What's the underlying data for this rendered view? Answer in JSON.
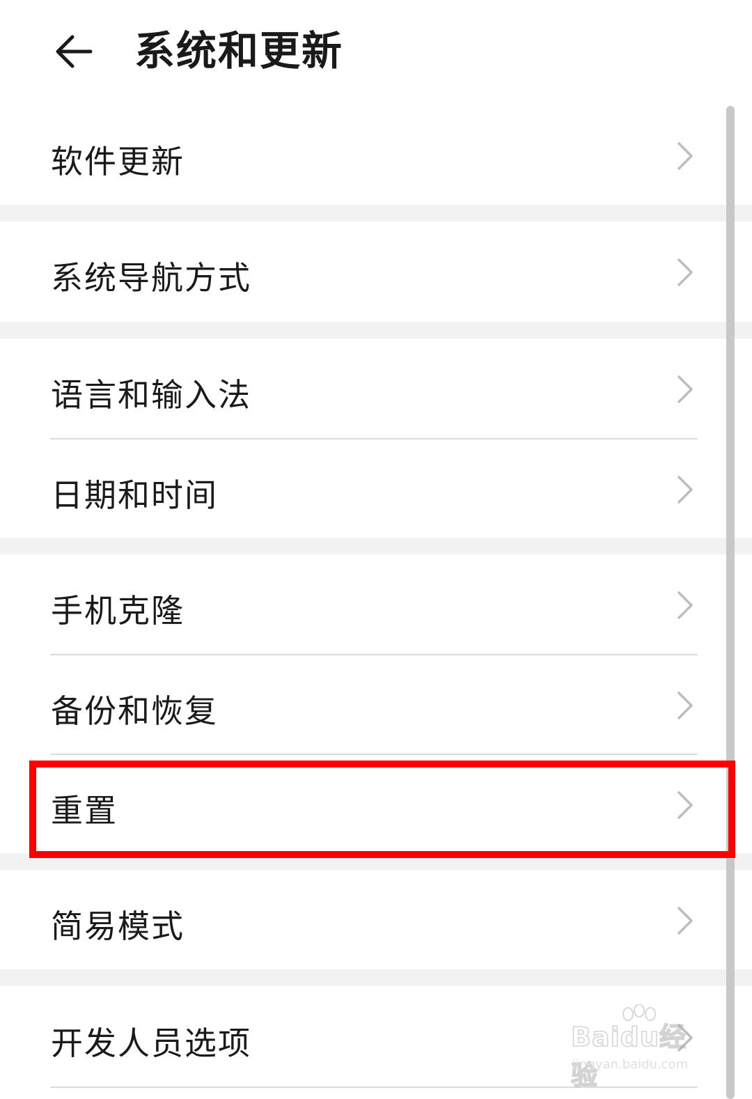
{
  "header": {
    "back_icon": "back-arrow-icon",
    "title": "系统和更新"
  },
  "menu_items": [
    {
      "label": "软件更新",
      "icon": "chevron-right-icon"
    },
    {
      "label": "系统导航方式",
      "icon": "chevron-right-icon"
    },
    {
      "label": "语言和输入法",
      "icon": "chevron-right-icon"
    },
    {
      "label": "日期和时间",
      "icon": "chevron-right-icon"
    },
    {
      "label": "手机克隆",
      "icon": "chevron-right-icon"
    },
    {
      "label": "备份和恢复",
      "icon": "chevron-right-icon"
    },
    {
      "label": "重置",
      "icon": "chevron-right-icon",
      "highlighted": true
    },
    {
      "label": "简易模式",
      "icon": "chevron-right-icon"
    },
    {
      "label": "开发人员选项",
      "icon": "chevron-right-icon"
    }
  ],
  "highlight_color": "#ff0000",
  "watermark": {
    "brand": "Baidu经验",
    "site": "jingyan.baidu.com"
  }
}
